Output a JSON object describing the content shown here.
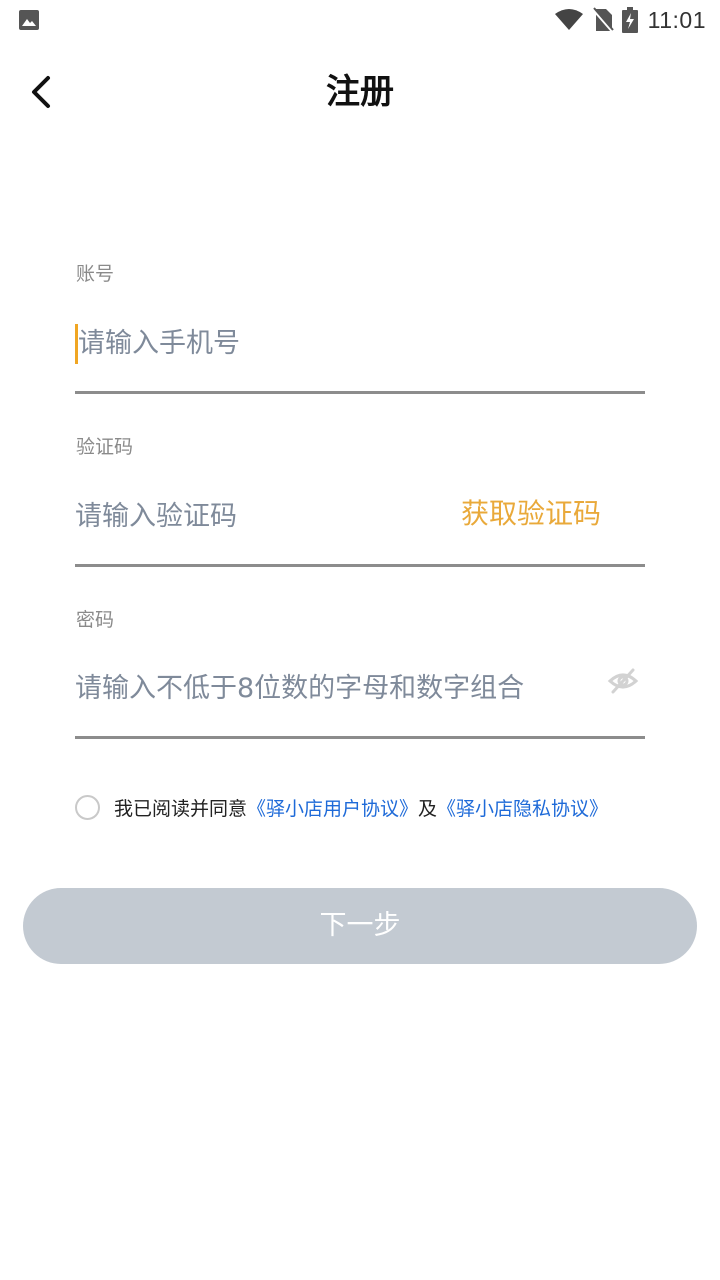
{
  "status_bar": {
    "time": "11:01",
    "icons": [
      "image-icon",
      "wifi-icon",
      "no-sim-icon",
      "battery-charging-icon"
    ]
  },
  "header": {
    "title": "注册",
    "back_icon": "chevron-left-icon"
  },
  "form": {
    "account": {
      "label": "账号",
      "placeholder": "请输入手机号",
      "value": ""
    },
    "code": {
      "label": "验证码",
      "placeholder": "请输入验证码",
      "value": "",
      "get_code_label": "获取验证码"
    },
    "password": {
      "label": "密码",
      "placeholder": "请输入不低于8位数的字母和数字组合",
      "value": "",
      "toggle_icon": "eye-off-icon"
    }
  },
  "agreement": {
    "checked": false,
    "prefix": "我已阅读并同意",
    "user_agreement": "《驿小店用户协议》",
    "conjunction": "及",
    "privacy_agreement": "《驿小店隐私协议》"
  },
  "next_button": {
    "label": "下一步"
  },
  "colors": {
    "accent": "#e9a93a",
    "link": "#1e6ad8",
    "button_disabled": "#c3cad2",
    "placeholder": "#7f8a9a",
    "underline": "#8c8c8c"
  }
}
